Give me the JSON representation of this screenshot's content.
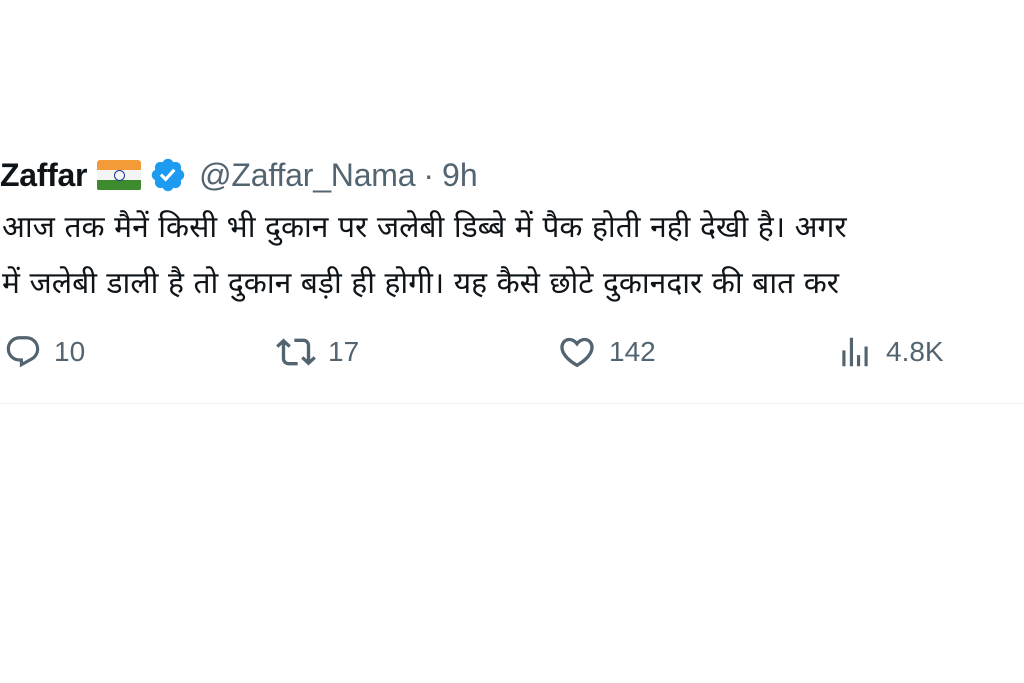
{
  "tweet": {
    "author": {
      "display_name": "Zaffar",
      "handle": "@Zaffar_Nama",
      "flag_icon": "india-flag-icon",
      "verified_icon": "verified-badge-icon",
      "verified_color": "#1d9bf0"
    },
    "separator": "·",
    "time": "9h",
    "text_lines": [
      "आज तक मैनें किसी भी दुकान पर जलेबी डिब्बे में पैक होती नही देखी है। अगर",
      "में जलेबी डाली है तो दुकान बड़ी ही होगी। यह कैसे छोटे दुकानदार की बात कर"
    ],
    "actions": {
      "replies": "10",
      "retweets": "17",
      "likes": "142",
      "views": "4.8K"
    }
  },
  "colors": {
    "text_primary": "#0f1419",
    "text_secondary": "#536471",
    "divider": "#eff3f4",
    "background": "#ffffff"
  }
}
